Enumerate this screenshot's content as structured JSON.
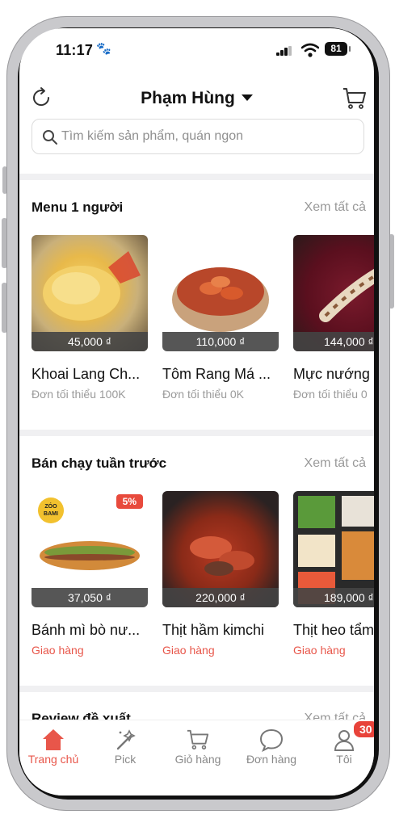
{
  "status": {
    "time": "11:17",
    "battery": "81"
  },
  "header": {
    "title": "Phạm Hùng"
  },
  "search": {
    "placeholder": "Tìm kiếm sản phẩm, quán ngon"
  },
  "sections": [
    {
      "title": "Menu 1 người",
      "see_all": "Xem tất cả",
      "items": [
        {
          "name": "Khoai Lang Ch...",
          "price": "45,000 ₫",
          "sub": "Đơn tối thiểu 100K"
        },
        {
          "name": "Tôm Rang Má ...",
          "price": "110,000 ₫",
          "sub": "Đơn tối thiểu 0K"
        },
        {
          "name": "Mực nướng",
          "price": "144,000 ₫",
          "sub": "Đơn tối thiểu 0"
        }
      ]
    },
    {
      "title": "Bán chạy tuần trước",
      "see_all": "Xem tất cả",
      "items": [
        {
          "name": "Bánh mì bò nư...",
          "price": "37,050 ₫",
          "sub": "Giao hàng",
          "discount": "5%",
          "logo": "ZÓO BAMI"
        },
        {
          "name": "Thịt hầm kimchi",
          "price": "220,000 ₫",
          "sub": "Giao hàng"
        },
        {
          "name": "Thịt heo tẩm",
          "price": "189,000 ₫",
          "sub": "Giao hàng"
        }
      ]
    },
    {
      "title": "Review đề xuất",
      "see_all": "Xem tất cả"
    }
  ],
  "tabs": [
    {
      "label": "Trang chủ",
      "icon": "home-icon"
    },
    {
      "label": "Pick",
      "icon": "magic-wand-icon"
    },
    {
      "label": "Giỏ hàng",
      "icon": "cart-icon"
    },
    {
      "label": "Đơn hàng",
      "icon": "chat-icon"
    },
    {
      "label": "Tôi",
      "icon": "user-icon",
      "badge": "30"
    }
  ],
  "colors": {
    "accent": "#e8564a",
    "badge": "#e8433a",
    "text": "#111111",
    "muted": "#999999"
  }
}
